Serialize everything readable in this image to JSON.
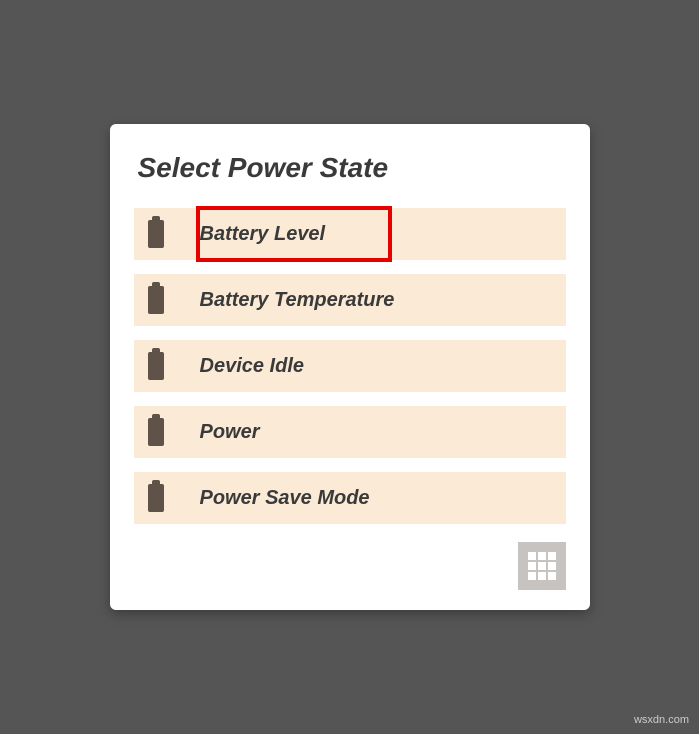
{
  "title": "Select Power State",
  "items": [
    {
      "label": "Battery Level",
      "highlighted": true
    },
    {
      "label": "Battery Temperature",
      "highlighted": false
    },
    {
      "label": "Device Idle",
      "highlighted": false
    },
    {
      "label": "Power",
      "highlighted": false
    },
    {
      "label": "Power Save Mode",
      "highlighted": false
    }
  ],
  "watermark": "wsxdn.com"
}
